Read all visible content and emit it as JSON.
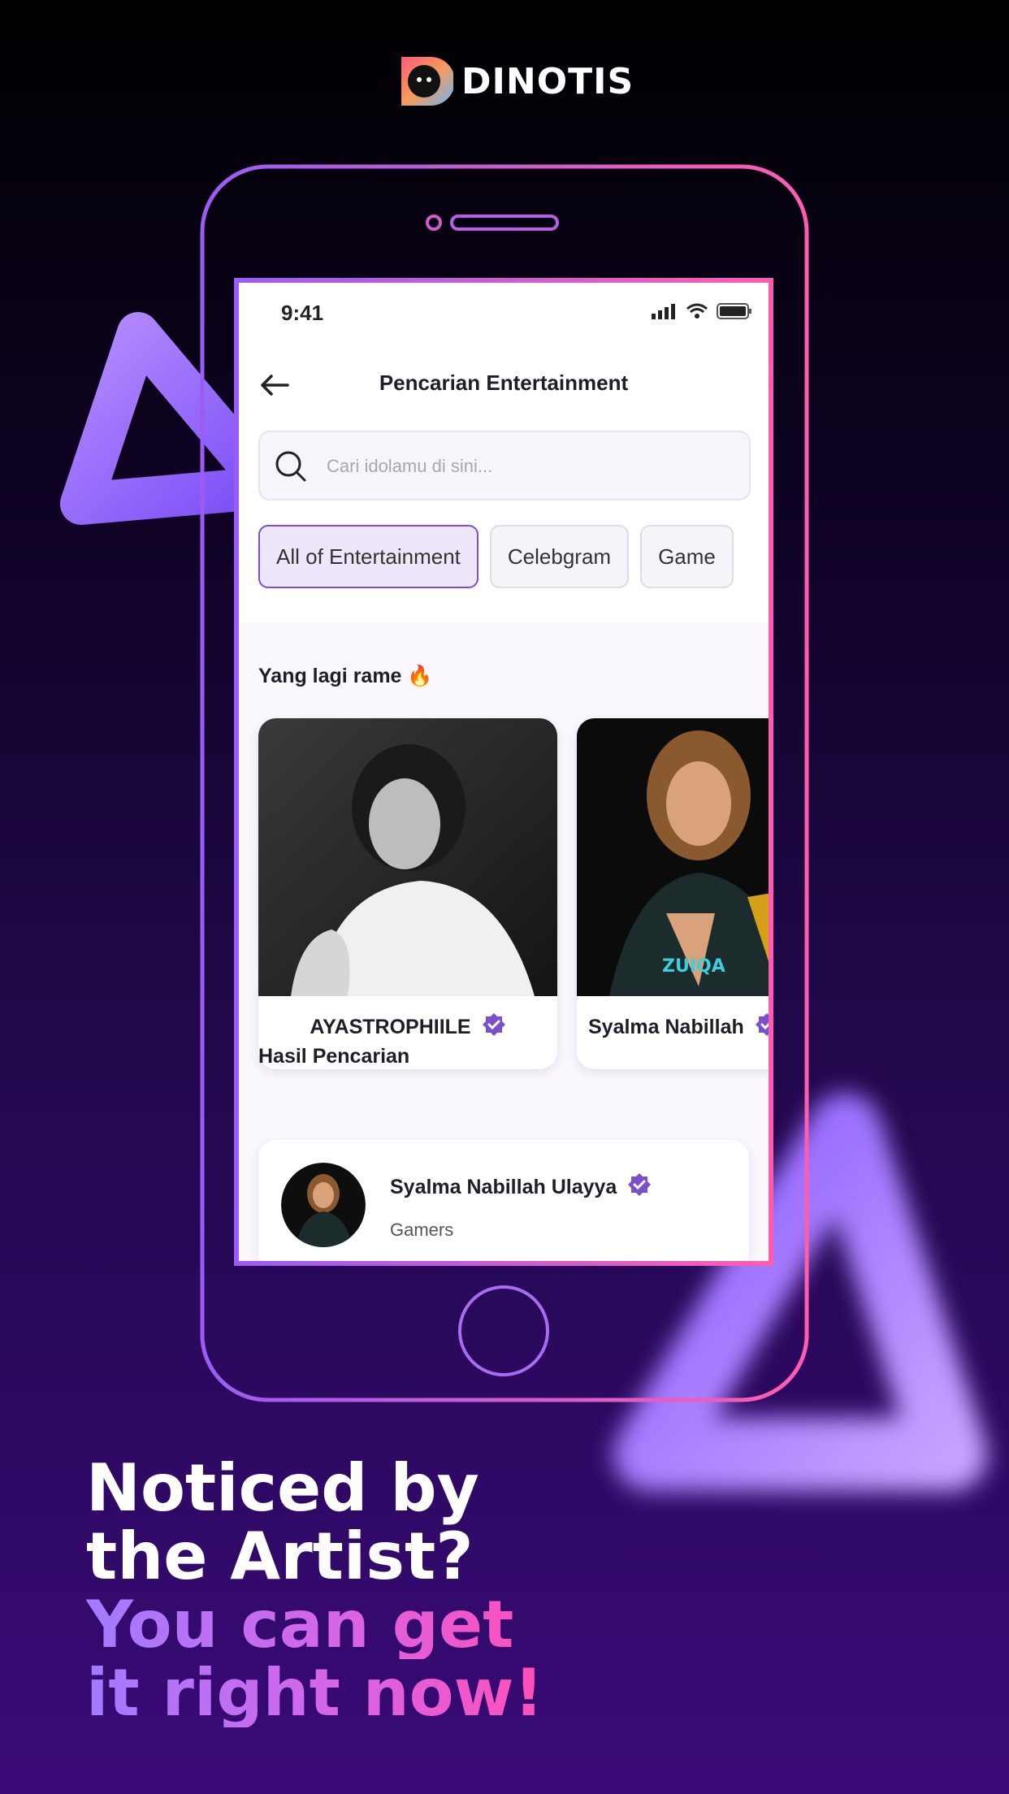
{
  "brand": {
    "name": "DINOTIS"
  },
  "status_bar": {
    "time": "9:41"
  },
  "nav": {
    "title": "Pencarian Entertainment"
  },
  "search": {
    "placeholder": "Cari idolamu di sini..."
  },
  "chips": [
    {
      "label": "All of Entertainment",
      "active": true
    },
    {
      "label": "Celebgram",
      "active": false
    },
    {
      "label": "Game",
      "active": false
    }
  ],
  "trending": {
    "title": "Yang lagi rame 🔥",
    "cards": [
      {
        "name": "AYASTROPHIILE",
        "verified": true
      },
      {
        "name": "Syalma Nabillah",
        "verified": true
      }
    ]
  },
  "results": {
    "title": "Hasil Pencarian",
    "items": [
      {
        "name": "Syalma Nabillah Ulayya",
        "category": "Gamers",
        "verified": true
      }
    ]
  },
  "headline": {
    "line1": "Noticed by",
    "line2": "the Artist?",
    "line3": "You can get",
    "line4": "it right now!"
  },
  "colors": {
    "accent": "#7b4fc9",
    "pink": "#ff4fb8",
    "purple": "#9a5cf5"
  },
  "icons": [
    "back-arrow-icon",
    "search-icon",
    "verified-badge-icon",
    "signal-icon",
    "wifi-icon",
    "battery-icon",
    "fire-emoji"
  ]
}
